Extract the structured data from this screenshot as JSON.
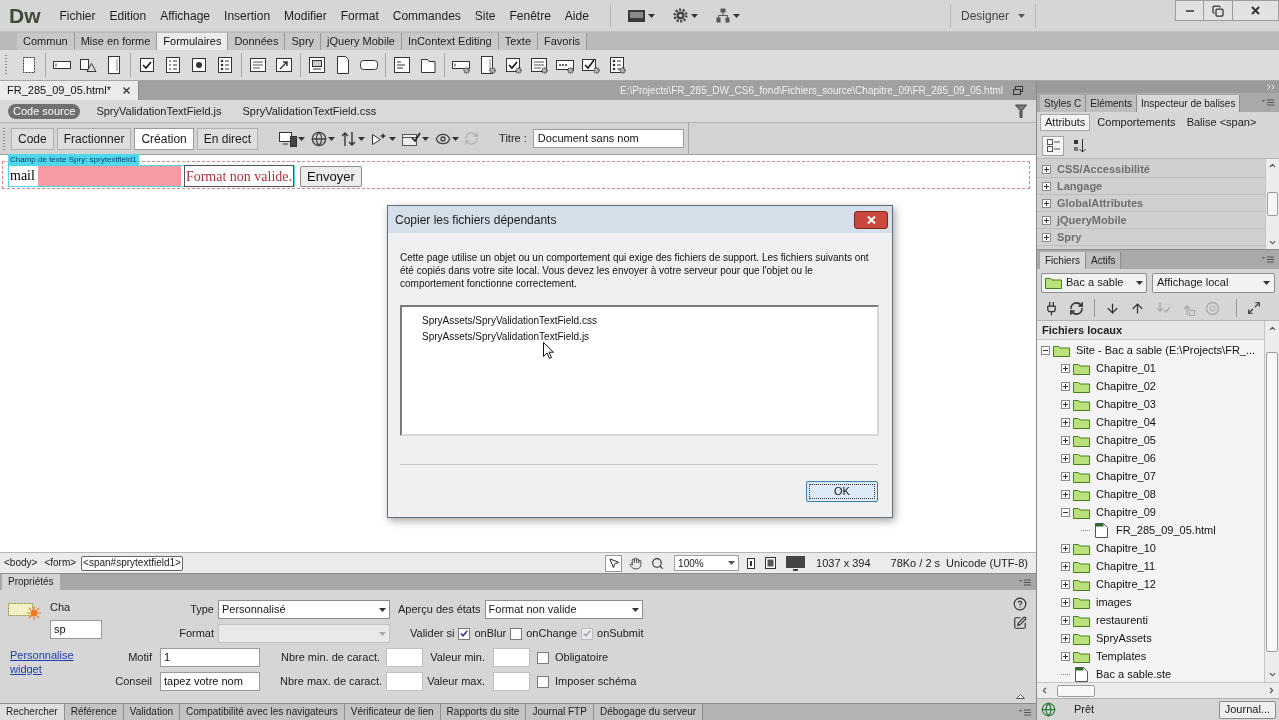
{
  "menu_bar": {
    "logo": "Dw",
    "items": [
      "Fichier",
      "Edition",
      "Affichage",
      "Insertion",
      "Modifier",
      "Format",
      "Commandes",
      "Site",
      "Fenêtre",
      "Aide"
    ],
    "workspace": "Designer"
  },
  "insert_tabs": [
    {
      "label": "Commun",
      "selected": false
    },
    {
      "label": "Mise en forme",
      "selected": false
    },
    {
      "label": "Formulaires",
      "selected": true
    },
    {
      "label": "Données",
      "selected": false
    },
    {
      "label": "Spry",
      "selected": false
    },
    {
      "label": "jQuery Mobile",
      "selected": false
    },
    {
      "label": "InContext Editing",
      "selected": false
    },
    {
      "label": "Texte",
      "selected": false
    },
    {
      "label": "Favoris",
      "selected": false
    }
  ],
  "document": {
    "tab": "FR_285_09_05.html*",
    "path": "E:\\Projects\\FR_285_DW_CS6_fond\\Fichiers_source\\Chapitre_09\\FR_285_09_05.html",
    "related_files": [
      {
        "label": "Code source",
        "selected": true
      },
      {
        "label": "SpryValidationTextField.js",
        "selected": false
      },
      {
        "label": "SpryValidationTextField.css",
        "selected": false
      }
    ],
    "views": [
      {
        "label": "Code",
        "selected": false
      },
      {
        "label": "Fractionner",
        "selected": false
      },
      {
        "label": "Création",
        "selected": true
      },
      {
        "label": "En direct",
        "selected": false
      }
    ],
    "title_label": "Titre :",
    "title_value": "Document sans nom"
  },
  "design_view": {
    "widget_label": "Champ de texte Spry: sprytextfield1",
    "field_label": "mail",
    "error_message": "Format non valide.",
    "submit_button": "Envoyer"
  },
  "dialog": {
    "title": "Copier les fichiers dépendants",
    "message": "Cette page utilise un objet ou un comportement qui exige des fichiers de support. Les fichiers suivants ont été copiés dans votre site local. Vous devez les envoyer à votre serveur pour que l'objet ou le comportement fonctionne correctement.",
    "files": [
      "SpryAssets/SpryValidationTextField.css",
      "SpryAssets/SpryValidationTextField.js"
    ],
    "ok_button": "OK"
  },
  "status_bar": {
    "tags": [
      {
        "label": "<body>",
        "selected": false
      },
      {
        "label": "<form>",
        "selected": false
      },
      {
        "label": "<span#sprytextfield1>",
        "selected": true
      }
    ],
    "tools": [
      {
        "kind": "pointer",
        "selected": true
      },
      {
        "kind": "hand",
        "selected": false
      },
      {
        "kind": "zoom",
        "selected": false
      }
    ],
    "zoom": "100%",
    "dimensions": "1037 x 394",
    "download": "78Ko / 2 s",
    "encoding": "Unicode (UTF-8)"
  },
  "properties": {
    "title": "Propriétés",
    "widget_type": "Cha",
    "widget_name": "sp",
    "customize_link": "Personnalise widget",
    "type": {
      "label": "Type",
      "value": "Personnalisé"
    },
    "format": {
      "label": "Format",
      "disabled": true
    },
    "state_preview": {
      "label": "Aperçu des états",
      "value": "Format non valide"
    },
    "validate_label": "Valider si",
    "validate_on": [
      {
        "label": "onBlur",
        "checked": true,
        "disabled": false
      },
      {
        "label": "onChange",
        "checked": false,
        "disabled": false
      },
      {
        "label": "onSubmit",
        "checked": true,
        "disabled": true
      }
    ],
    "pattern": {
      "label": "Motif",
      "value": "1"
    },
    "hint": {
      "label": "Conseil",
      "value": "tapez votre nom"
    },
    "min_chars_label": "Nbre min. de caract.",
    "max_chars_label": "Nbre max. de caract.",
    "min_value_label": "Valeur min.",
    "max_value_label": "Valeur max.",
    "options": [
      {
        "label": "Obligatoire",
        "checked": false
      },
      {
        "label": "Imposer schéma",
        "checked": false
      }
    ]
  },
  "results_tabs": [
    {
      "label": "Rechercher",
      "selected": true
    },
    {
      "label": "Référence",
      "selected": false
    },
    {
      "label": "Validation",
      "selected": false
    },
    {
      "label": "Compatibilité avec les navigateurs",
      "selected": false
    },
    {
      "label": "Vérificateur de lien",
      "selected": false
    },
    {
      "label": "Rapports du site",
      "selected": false
    },
    {
      "label": "Journal FTP",
      "selected": false
    },
    {
      "label": "Débogage du serveur",
      "selected": false
    }
  ],
  "tag_inspector": {
    "tabs": [
      {
        "label": "Styles C",
        "selected": false
      },
      {
        "label": "Eléments",
        "selected": false
      },
      {
        "label": "Inspecteur de balises",
        "selected": true
      }
    ],
    "subtabs": [
      {
        "label": "Attributs",
        "selected": true
      },
      {
        "label": "Comportements",
        "selected": false
      }
    ],
    "tag": "Balise <span>",
    "categories": [
      {
        "label": "CSS/Accessibilité",
        "expanded": false
      },
      {
        "label": "Langage",
        "expanded": false
      },
      {
        "label": "GlobalAttributes",
        "expanded": false
      },
      {
        "label": "jQueryMobile",
        "expanded": false
      },
      {
        "label": "Spry",
        "expanded": false
      }
    ]
  },
  "files_panel": {
    "tabs": [
      {
        "label": "Fichiers",
        "selected": true
      },
      {
        "label": "Actifs",
        "selected": false
      }
    ],
    "site": "Bac a sable",
    "view": "Affichage local",
    "header": "Fichiers locaux",
    "tree": [
      {
        "label": "Site - Bac a sable (E:\\Projects\\FR_...",
        "kind": "folder",
        "expanded": true,
        "children": [
          {
            "label": "Chapitre_01",
            "kind": "folder",
            "expanded": false
          },
          {
            "label": "Chapitre_02",
            "kind": "folder",
            "expanded": false
          },
          {
            "label": "Chapitre_03",
            "kind": "folder",
            "expanded": false
          },
          {
            "label": "Chapitre_04",
            "kind": "folder",
            "expanded": false
          },
          {
            "label": "Chapitre_05",
            "kind": "folder",
            "expanded": false
          },
          {
            "label": "Chapitre_06",
            "kind": "folder",
            "expanded": false
          },
          {
            "label": "Chapitre_07",
            "kind": "folder",
            "expanded": false
          },
          {
            "label": "Chapitre_08",
            "kind": "folder",
            "expanded": false
          },
          {
            "label": "Chapitre_09",
            "kind": "folder",
            "expanded": true,
            "children": [
              {
                "label": "FR_285_09_05.html",
                "kind": "file"
              }
            ]
          },
          {
            "label": "Chapitre_10",
            "kind": "folder",
            "expanded": false
          },
          {
            "label": "Chapitre_11",
            "kind": "folder",
            "expanded": false
          },
          {
            "label": "Chapitre_12",
            "kind": "folder",
            "expanded": false
          },
          {
            "label": "images",
            "kind": "folder",
            "expanded": false
          },
          {
            "label": "restaurenti",
            "kind": "folder",
            "expanded": false
          },
          {
            "label": "SpryAssets",
            "kind": "folder",
            "expanded": false
          },
          {
            "label": "Templates",
            "kind": "folder",
            "expanded": false
          },
          {
            "label": "Bac a sable.ste",
            "kind": "file"
          }
        ]
      }
    ],
    "status": "Prêt",
    "log_button": "Journal..."
  }
}
